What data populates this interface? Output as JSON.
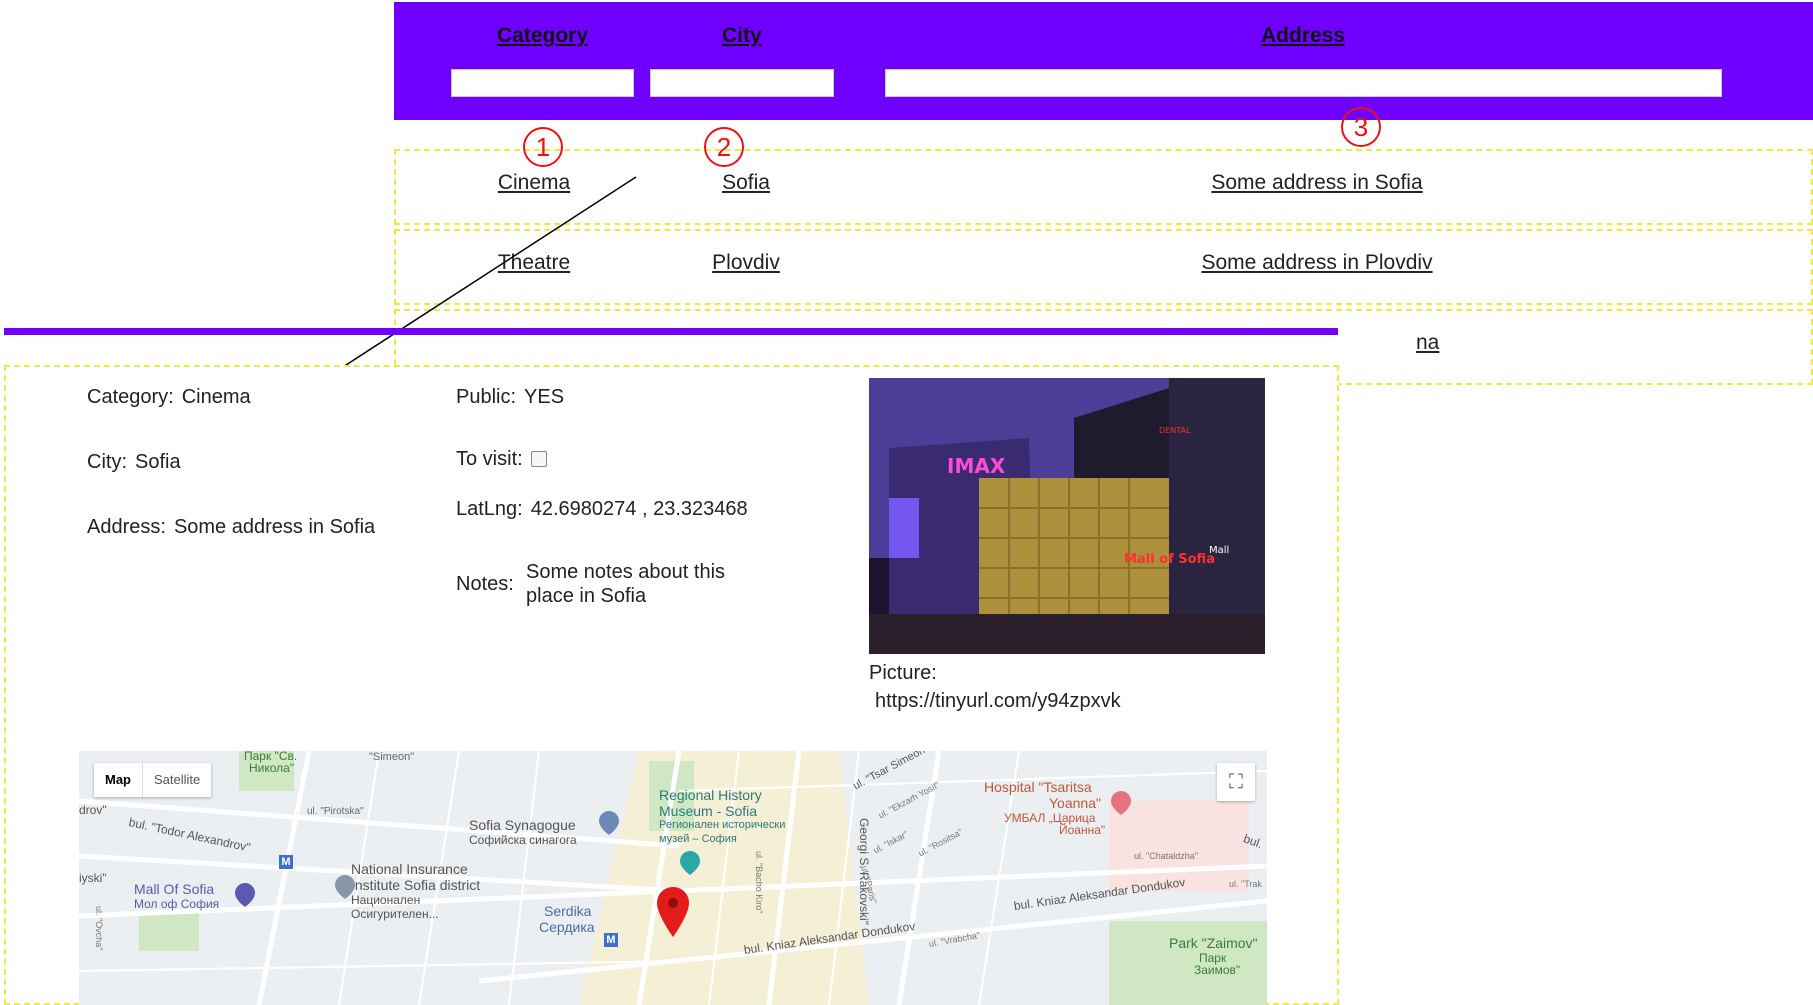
{
  "header": {
    "category_label": "Category",
    "city_label": "City",
    "address_label": "Address",
    "category_filter": "",
    "city_filter": "",
    "address_filter": ""
  },
  "callouts": [
    "1",
    "2",
    "3"
  ],
  "rows": [
    {
      "category": "Cinema",
      "city": "Sofia",
      "address": "Some address in Sofia"
    },
    {
      "category": "Theatre",
      "city": "Plovdiv",
      "address": "Some address in Plovdiv"
    },
    {
      "category": "",
      "city": "",
      "address": "na"
    }
  ],
  "detail": {
    "category_key": "Category:",
    "category_value": "Cinema",
    "city_key": "City:",
    "city_value": "Sofia",
    "address_key": "Address:",
    "address_value": "Some address in Sofia",
    "public_key": "Public:",
    "public_value": "YES",
    "to_visit_key": "To visit:",
    "latlng_key": "LatLng:",
    "latlng_value": "42.6980274 , 23.323468",
    "notes_key": "Notes:",
    "notes_value_line1": "Some notes about this",
    "notes_value_line2": "place in Sofia",
    "picture_key": "Picture:",
    "picture_url": "https://tinyurl.com/y94zpxvk",
    "photo_signs": [
      "IMAX",
      "Mall of Sofia",
      "DENTAL",
      "Mall"
    ]
  },
  "map": {
    "map_button": "Map",
    "satellite_button": "Satellite",
    "labels": {
      "park_sv_nikola_bg": "Парк \"Св.",
      "park_sv_nikola_bg2": "Никола\"",
      "simeon": "\"Simeon\"",
      "todor_alexandrov": "bul. \"Todor Alexandrov\"",
      "pirotska": "ul. \"Pirotska\"",
      "drov": "drov\"",
      "sofia_synagogue": "Sofia Synagogue",
      "sofia_synagogue_bg": "Софийска синагога",
      "regional_history_1": "Regional History",
      "regional_history_2": "Museum - Sofia",
      "regional_history_bg1": "Регионален исторически",
      "regional_history_bg2": "музей – София",
      "georgi_rakovski": "Georgi S. Rakovski\"",
      "tsar_simeon": "ul. \"Tsar Simeon\"",
      "ekzarh_yosif": "ul. \"Ekzarh Yosif\"",
      "iskar": "ul. \"Iskar\"",
      "rositsa": "ul. \"Rositsa\"",
      "hospital_1": "Hospital \"Tsaritsa",
      "hospital_2": "Yoanna\"",
      "hospital_bg1": "УМБАЛ „Царица",
      "hospital_bg2": "Йоанна\"",
      "chataldzha": "ul. \"Chataldzha\"",
      "iyski": "iyski\"",
      "mall_of_sofia": "Mall Of Sofia",
      "mall_of_sofia_bg": "Мол оф София",
      "national_insurance_1": "National Insurance",
      "national_insurance_2": "Institute Sofia district",
      "national_insurance_bg1": "Национален",
      "national_insurance_bg2": "Осигурителен...",
      "serdika": "Serdika",
      "serdika_bg": "Сердика",
      "bacho_kiro": "ul. \"Bacho Kiro\"",
      "paris": "ul. \"Paris\"",
      "dondukov_1": "bul. Kniaz Aleksandar Dondukov",
      "dondukov_2": "bul. Kniaz Aleksandar Dondukov",
      "vrabcha": "ul. \"Vrabcha\"",
      "trak": "ul. \"Trak",
      "bul": "bul.",
      "park_zaimov": "Park \"Zaimov\"",
      "park_zaimov_bg1": "Парк",
      "park_zaimov_bg2": "Заимов\"",
      "ovcha": "ul. \"Ovcha\"",
      "metro": "M"
    }
  }
}
